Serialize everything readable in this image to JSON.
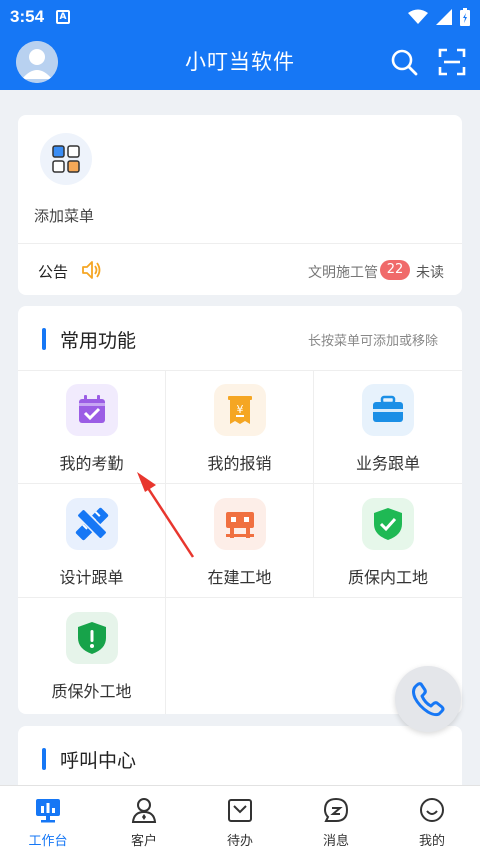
{
  "status_bar": {
    "time": "3:54",
    "a_icon": "A"
  },
  "header": {
    "title": "小叮当软件"
  },
  "menu_card": {
    "add_label": "添加菜单",
    "notice_label": "公告",
    "notice_text": "文明施工管",
    "unread_count": "22",
    "unread_label": "未读"
  },
  "functions": {
    "title": "常用功能",
    "hint": "长按菜单可添加或移除",
    "items": [
      {
        "label": "我的考勤",
        "icon": "calendar-check-icon",
        "bg": "#f1ebfd",
        "color": "#9b5de5"
      },
      {
        "label": "我的报销",
        "icon": "receipt-yen-icon",
        "bg": "#fdf3e6",
        "color": "#f5a623"
      },
      {
        "label": "业务跟单",
        "icon": "briefcase-icon",
        "bg": "#e7f2fc",
        "color": "#1b8fe6"
      },
      {
        "label": "设计跟单",
        "icon": "design-ruler-icon",
        "bg": "#e8f0fd",
        "color": "#1677f5"
      },
      {
        "label": "在建工地",
        "icon": "construction-icon",
        "bg": "#fdeee8",
        "color": "#f07040"
      },
      {
        "label": "质保内工地",
        "icon": "shield-check-icon",
        "bg": "#e6f7ea",
        "color": "#1fb954"
      },
      {
        "label": "质保外工地",
        "icon": "shield-alert-icon",
        "bg": "#e6f4ea",
        "color": "#17a34a"
      }
    ]
  },
  "call_center": {
    "title": "呼叫中心"
  },
  "bottom_nav": [
    {
      "label": "工作台",
      "icon": "dashboard-icon",
      "active": true
    },
    {
      "label": "客户",
      "icon": "customer-icon",
      "active": false
    },
    {
      "label": "待办",
      "icon": "todo-icon",
      "active": false
    },
    {
      "label": "消息",
      "icon": "message-icon",
      "active": false
    },
    {
      "label": "我的",
      "icon": "profile-icon",
      "active": false
    }
  ],
  "colors": {
    "primary": "#1677f5",
    "badge": "#f06a6a",
    "arrow": "#e8362e"
  }
}
